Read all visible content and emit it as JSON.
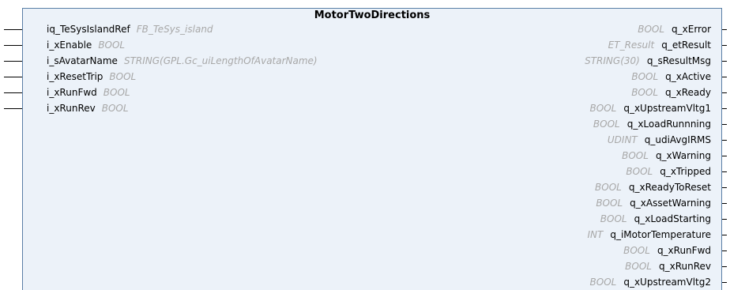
{
  "block": {
    "title": "MotorTwoDirections"
  },
  "inputs": [
    {
      "name": "iq_TeSysIslandRef",
      "type": "FB_TeSys_island"
    },
    {
      "name": "i_xEnable",
      "type": "BOOL"
    },
    {
      "name": "i_sAvatarName",
      "type": "STRING(GPL.Gc_uiLengthOfAvatarName)"
    },
    {
      "name": "i_xResetTrip",
      "type": "BOOL"
    },
    {
      "name": "i_xRunFwd",
      "type": "BOOL"
    },
    {
      "name": "i_xRunRev",
      "type": "BOOL"
    }
  ],
  "outputs": [
    {
      "name": "q_xError",
      "type": "BOOL"
    },
    {
      "name": "q_etResult",
      "type": "ET_Result"
    },
    {
      "name": "q_sResultMsg",
      "type": "STRING(30)"
    },
    {
      "name": "q_xActive",
      "type": "BOOL"
    },
    {
      "name": "q_xReady",
      "type": "BOOL"
    },
    {
      "name": "q_xUpstreamVltg1",
      "type": "BOOL"
    },
    {
      "name": "q_xLoadRunnning",
      "type": "BOOL"
    },
    {
      "name": "q_udiAvgIRMS",
      "type": "UDINT"
    },
    {
      "name": "q_xWarning",
      "type": "BOOL"
    },
    {
      "name": "q_xTripped",
      "type": "BOOL"
    },
    {
      "name": "q_xReadyToReset",
      "type": "BOOL"
    },
    {
      "name": "q_xAssetWarning",
      "type": "BOOL"
    },
    {
      "name": "q_xLoadStarting",
      "type": "BOOL"
    },
    {
      "name": "q_iMotorTemperature",
      "type": "INT"
    },
    {
      "name": "q_xRunFwd",
      "type": "BOOL"
    },
    {
      "name": "q_xRunRev",
      "type": "BOOL"
    },
    {
      "name": "q_xUpstreamVltg2",
      "type": "BOOL"
    }
  ]
}
